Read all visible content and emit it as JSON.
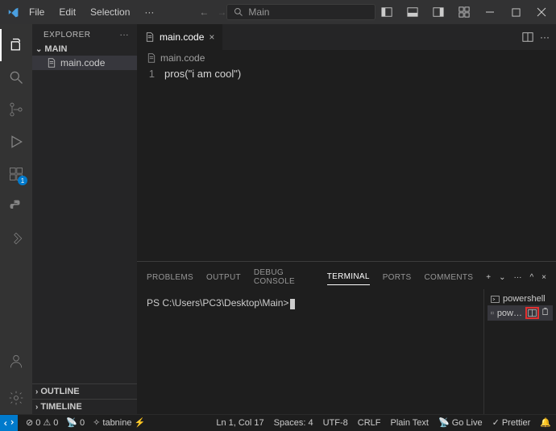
{
  "menu": {
    "file": "File",
    "edit": "Edit",
    "selection": "Selection",
    "more": "···"
  },
  "search": {
    "placeholder": "Main"
  },
  "sidebar": {
    "title": "EXPLORER",
    "folder": "MAIN",
    "file": "main.code",
    "outline": "OUTLINE",
    "timeline": "TIMELINE"
  },
  "tab": {
    "name": "main.code"
  },
  "breadcrumb": {
    "file": "main.code"
  },
  "code": {
    "lineNum": "1",
    "text": "pros(\"i am cool\")"
  },
  "panel": {
    "tabs": {
      "problems": "PROBLEMS",
      "output": "OUTPUT",
      "debug": "DEBUG CONSOLE",
      "terminal": "TERMINAL",
      "ports": "PORTS",
      "comments": "COMMENTS"
    },
    "prompt": "PS C:\\Users\\PC3\\Desktop\\Main>",
    "terms": {
      "t1": "powershell",
      "t2": "pow…"
    }
  },
  "status": {
    "errors": "0",
    "warnings": "0",
    "ports": "0",
    "tabnine": "tabnine",
    "lncol": "Ln 1, Col 17",
    "spaces": "Spaces: 4",
    "encoding": "UTF-8",
    "eol": "CRLF",
    "lang": "Plain Text",
    "golive": "Go Live",
    "prettier": "Prettier"
  },
  "activity": {
    "ext_badge": "1"
  }
}
